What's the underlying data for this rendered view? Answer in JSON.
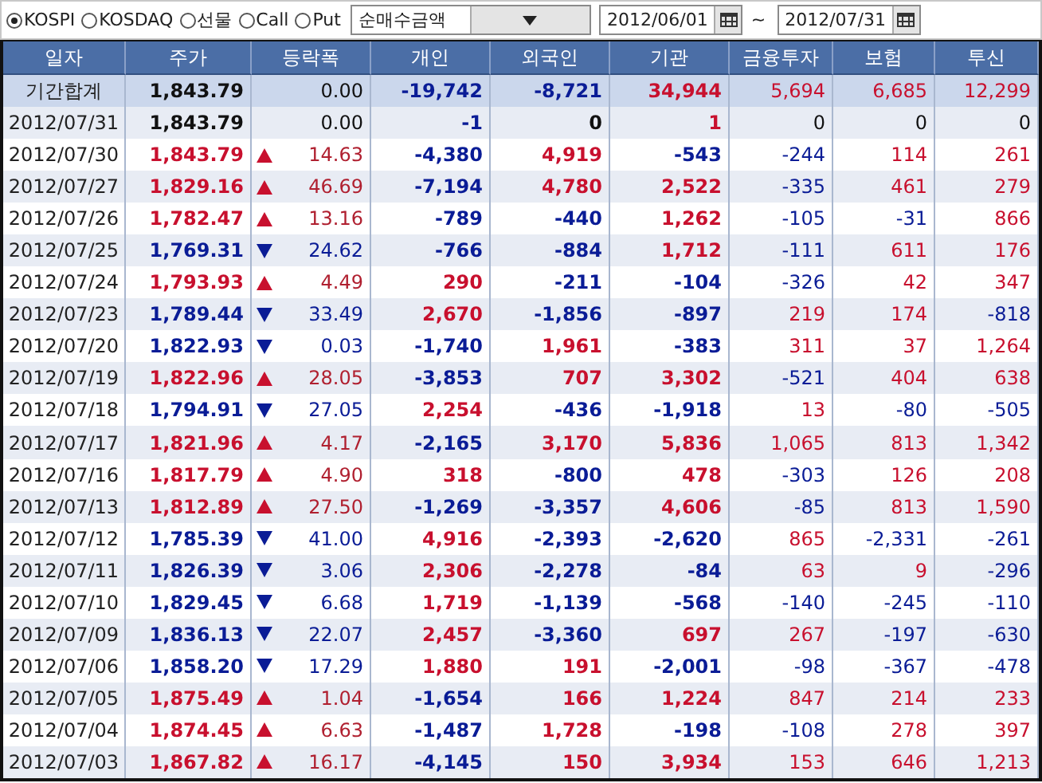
{
  "filters": {
    "markets": [
      {
        "label": "KOSPI",
        "selected": true
      },
      {
        "label": "KOSDAQ",
        "selected": false
      },
      {
        "label": "선물",
        "selected": false
      },
      {
        "label": "Call",
        "selected": false
      },
      {
        "label": "Put",
        "selected": false
      }
    ],
    "measure": {
      "value": "순매수금액"
    },
    "date_from": "2012/06/01",
    "separator": "~",
    "date_to": "2012/07/31"
  },
  "table": {
    "columns": [
      "일자",
      "주가",
      "등락폭",
      "개인",
      "외국인",
      "기관",
      "금융투자",
      "보험",
      "투신"
    ],
    "rows": [
      {
        "kind": "total",
        "date": "기간합계",
        "price": "1,843.79",
        "rising": false,
        "falling": false,
        "change": "0.00",
        "flows": [
          "-19,742",
          "-8,721",
          "34,944",
          "5,694",
          "6,685",
          "12,299"
        ]
      },
      {
        "kind": "day",
        "date": "2012/07/31",
        "price": "1,843.79",
        "rising": false,
        "falling": false,
        "change": "0.00",
        "flows": [
          "-1",
          "0",
          "1",
          "0",
          "0",
          "0"
        ]
      },
      {
        "kind": "day",
        "date": "2012/07/30",
        "price": "1,843.79",
        "rising": true,
        "falling": false,
        "change": "14.63",
        "flows": [
          "-4,380",
          "4,919",
          "-543",
          "-244",
          "114",
          "261"
        ]
      },
      {
        "kind": "day",
        "date": "2012/07/27",
        "price": "1,829.16",
        "rising": true,
        "falling": false,
        "change": "46.69",
        "flows": [
          "-7,194",
          "4,780",
          "2,522",
          "-335",
          "461",
          "279"
        ]
      },
      {
        "kind": "day",
        "date": "2012/07/26",
        "price": "1,782.47",
        "rising": true,
        "falling": false,
        "change": "13.16",
        "flows": [
          "-789",
          "-440",
          "1,262",
          "-105",
          "-31",
          "866"
        ]
      },
      {
        "kind": "day",
        "date": "2012/07/25",
        "price": "1,769.31",
        "rising": false,
        "falling": true,
        "change": "24.62",
        "flows": [
          "-766",
          "-884",
          "1,712",
          "-111",
          "611",
          "176"
        ]
      },
      {
        "kind": "day",
        "date": "2012/07/24",
        "price": "1,793.93",
        "rising": true,
        "falling": false,
        "change": "4.49",
        "flows": [
          "290",
          "-211",
          "-104",
          "-326",
          "42",
          "347"
        ]
      },
      {
        "kind": "day",
        "date": "2012/07/23",
        "price": "1,789.44",
        "rising": false,
        "falling": true,
        "change": "33.49",
        "flows": [
          "2,670",
          "-1,856",
          "-897",
          "219",
          "174",
          "-818"
        ]
      },
      {
        "kind": "day",
        "date": "2012/07/20",
        "price": "1,822.93",
        "rising": false,
        "falling": true,
        "change": "0.03",
        "flows": [
          "-1,740",
          "1,961",
          "-383",
          "311",
          "37",
          "1,264"
        ]
      },
      {
        "kind": "day",
        "date": "2012/07/19",
        "price": "1,822.96",
        "rising": true,
        "falling": false,
        "change": "28.05",
        "flows": [
          "-3,853",
          "707",
          "3,302",
          "-521",
          "404",
          "638"
        ]
      },
      {
        "kind": "day",
        "date": "2012/07/18",
        "price": "1,794.91",
        "rising": false,
        "falling": true,
        "change": "27.05",
        "flows": [
          "2,254",
          "-436",
          "-1,918",
          "13",
          "-80",
          "-505"
        ]
      },
      {
        "kind": "day",
        "date": "2012/07/17",
        "price": "1,821.96",
        "rising": true,
        "falling": false,
        "change": "4.17",
        "flows": [
          "-2,165",
          "3,170",
          "5,836",
          "1,065",
          "813",
          "1,342"
        ]
      },
      {
        "kind": "day",
        "date": "2012/07/16",
        "price": "1,817.79",
        "rising": true,
        "falling": false,
        "change": "4.90",
        "flows": [
          "318",
          "-800",
          "478",
          "-303",
          "126",
          "208"
        ]
      },
      {
        "kind": "day",
        "date": "2012/07/13",
        "price": "1,812.89",
        "rising": true,
        "falling": false,
        "change": "27.50",
        "flows": [
          "-1,269",
          "-3,357",
          "4,606",
          "-85",
          "813",
          "1,590"
        ]
      },
      {
        "kind": "day",
        "date": "2012/07/12",
        "price": "1,785.39",
        "rising": false,
        "falling": true,
        "change": "41.00",
        "flows": [
          "4,916",
          "-2,393",
          "-2,620",
          "865",
          "-2,331",
          "-261"
        ]
      },
      {
        "kind": "day",
        "date": "2012/07/11",
        "price": "1,826.39",
        "rising": false,
        "falling": true,
        "change": "3.06",
        "flows": [
          "2,306",
          "-2,278",
          "-84",
          "63",
          "9",
          "-296"
        ]
      },
      {
        "kind": "day",
        "date": "2012/07/10",
        "price": "1,829.45",
        "rising": false,
        "falling": true,
        "change": "6.68",
        "flows": [
          "1,719",
          "-1,139",
          "-568",
          "-140",
          "-245",
          "-110"
        ]
      },
      {
        "kind": "day",
        "date": "2012/07/09",
        "price": "1,836.13",
        "rising": false,
        "falling": true,
        "change": "22.07",
        "flows": [
          "2,457",
          "-3,360",
          "697",
          "267",
          "-197",
          "-630"
        ]
      },
      {
        "kind": "day",
        "date": "2012/07/06",
        "price": "1,858.20",
        "rising": false,
        "falling": true,
        "change": "17.29",
        "flows": [
          "1,880",
          "191",
          "-2,001",
          "-98",
          "-367",
          "-478"
        ]
      },
      {
        "kind": "day",
        "date": "2012/07/05",
        "price": "1,875.49",
        "rising": true,
        "falling": false,
        "change": "1.04",
        "flows": [
          "-1,654",
          "166",
          "1,224",
          "847",
          "214",
          "233"
        ]
      },
      {
        "kind": "day",
        "date": "2012/07/04",
        "price": "1,874.45",
        "rising": true,
        "falling": false,
        "change": "6.63",
        "flows": [
          "-1,487",
          "1,728",
          "-198",
          "-108",
          "278",
          "397"
        ]
      },
      {
        "kind": "day",
        "date": "2012/07/03",
        "price": "1,867.82",
        "rising": true,
        "falling": false,
        "change": "16.17",
        "flows": [
          "-4,145",
          "150",
          "3,934",
          "153",
          "646",
          "1,213"
        ]
      }
    ]
  }
}
